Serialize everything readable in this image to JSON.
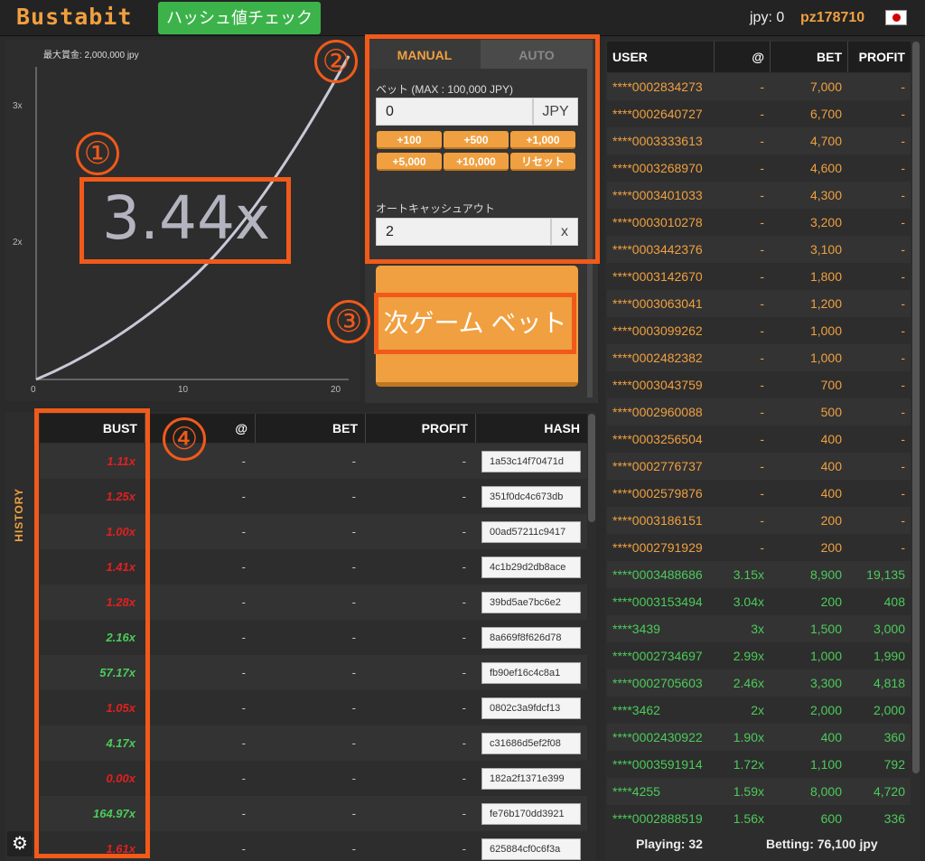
{
  "header": {
    "logo": "Bustabit",
    "hash_check_button": "ハッシュ値チェック",
    "balance_label": "jpy:",
    "balance_value": "0",
    "username": "pz178710"
  },
  "chart": {
    "max_profit_label": "最大賞金: 2,000,000 jpy",
    "current_multiplier": "3.44x",
    "y_ticks": [
      "3x",
      "2x"
    ],
    "x_ticks": [
      "0",
      "10",
      "20"
    ]
  },
  "annotations": [
    "①",
    "②",
    "③",
    "④"
  ],
  "bet_panel": {
    "tabs": [
      "MANUAL",
      "AUTO"
    ],
    "active_tab": "MANUAL",
    "bet_label": "ベット (MAX : 100,000 JPY)",
    "bet_value": "0",
    "currency": "JPY",
    "quick_buttons": [
      "+100",
      "+500",
      "+1,000",
      "+5,000",
      "+10,000",
      "リセット"
    ],
    "auto_cashout_label": "オートキャッシュアウト",
    "auto_cashout_value": "2",
    "auto_cashout_suffix": "x",
    "next_bet_button": "次ゲーム ベット",
    "accent_color": "#f0a040"
  },
  "history": {
    "side_label": "HISTORY",
    "columns": [
      "BUST",
      "@",
      "BET",
      "PROFIT",
      "HASH"
    ],
    "rows": [
      {
        "bust": "1.11x",
        "at": "-",
        "bet": "-",
        "profit": "-",
        "hash": "1a53c14f70471d",
        "status": "loss"
      },
      {
        "bust": "1.25x",
        "at": "-",
        "bet": "-",
        "profit": "-",
        "hash": "351f0dc4c673db",
        "status": "loss"
      },
      {
        "bust": "1.00x",
        "at": "-",
        "bet": "-",
        "profit": "-",
        "hash": "00ad57211c9417",
        "status": "loss"
      },
      {
        "bust": "1.41x",
        "at": "-",
        "bet": "-",
        "profit": "-",
        "hash": "4c1b29d2db8ace",
        "status": "loss"
      },
      {
        "bust": "1.28x",
        "at": "-",
        "bet": "-",
        "profit": "-",
        "hash": "39bd5ae7bc6e2",
        "status": "loss"
      },
      {
        "bust": "2.16x",
        "at": "-",
        "bet": "-",
        "profit": "-",
        "hash": "8a669f8f626d78",
        "status": "win"
      },
      {
        "bust": "57.17x",
        "at": "-",
        "bet": "-",
        "profit": "-",
        "hash": "fb90ef16c4c8a1",
        "status": "win"
      },
      {
        "bust": "1.05x",
        "at": "-",
        "bet": "-",
        "profit": "-",
        "hash": "0802c3a9fdcf13",
        "status": "loss"
      },
      {
        "bust": "4.17x",
        "at": "-",
        "bet": "-",
        "profit": "-",
        "hash": "c31686d5ef2f08",
        "status": "win"
      },
      {
        "bust": "0.00x",
        "at": "-",
        "bet": "-",
        "profit": "-",
        "hash": "182a2f1371e399",
        "status": "loss"
      },
      {
        "bust": "164.97x",
        "at": "-",
        "bet": "-",
        "profit": "-",
        "hash": "fe76b170dd3921",
        "status": "win"
      },
      {
        "bust": "1.61x",
        "at": "-",
        "bet": "-",
        "profit": "-",
        "hash": "625884cf0c6f3a",
        "status": "loss"
      }
    ],
    "win_color": "#4ccb5a",
    "loss_color": "#e02020"
  },
  "players": {
    "columns": [
      "USER",
      "@",
      "BET",
      "PROFIT"
    ],
    "rows": [
      {
        "user": "****0002834273",
        "at": "-",
        "bet": "7,000",
        "profit": "-",
        "status": "playing"
      },
      {
        "user": "****0002640727",
        "at": "-",
        "bet": "6,700",
        "profit": "-",
        "status": "playing"
      },
      {
        "user": "****0003333613",
        "at": "-",
        "bet": "4,700",
        "profit": "-",
        "status": "playing"
      },
      {
        "user": "****0003268970",
        "at": "-",
        "bet": "4,600",
        "profit": "-",
        "status": "playing"
      },
      {
        "user": "****0003401033",
        "at": "-",
        "bet": "4,300",
        "profit": "-",
        "status": "playing"
      },
      {
        "user": "****0003010278",
        "at": "-",
        "bet": "3,200",
        "profit": "-",
        "status": "playing"
      },
      {
        "user": "****0003442376",
        "at": "-",
        "bet": "3,100",
        "profit": "-",
        "status": "playing"
      },
      {
        "user": "****0003142670",
        "at": "-",
        "bet": "1,800",
        "profit": "-",
        "status": "playing"
      },
      {
        "user": "****0003063041",
        "at": "-",
        "bet": "1,200",
        "profit": "-",
        "status": "playing"
      },
      {
        "user": "****0003099262",
        "at": "-",
        "bet": "1,000",
        "profit": "-",
        "status": "playing"
      },
      {
        "user": "****0002482382",
        "at": "-",
        "bet": "1,000",
        "profit": "-",
        "status": "playing"
      },
      {
        "user": "****0003043759",
        "at": "-",
        "bet": "700",
        "profit": "-",
        "status": "playing"
      },
      {
        "user": "****0002960088",
        "at": "-",
        "bet": "500",
        "profit": "-",
        "status": "playing"
      },
      {
        "user": "****0003256504",
        "at": "-",
        "bet": "400",
        "profit": "-",
        "status": "playing"
      },
      {
        "user": "****0002776737",
        "at": "-",
        "bet": "400",
        "profit": "-",
        "status": "playing"
      },
      {
        "user": "****0002579876",
        "at": "-",
        "bet": "400",
        "profit": "-",
        "status": "playing"
      },
      {
        "user": "****0003186151",
        "at": "-",
        "bet": "200",
        "profit": "-",
        "status": "playing"
      },
      {
        "user": "****0002791929",
        "at": "-",
        "bet": "200",
        "profit": "-",
        "status": "playing"
      },
      {
        "user": "****0003488686",
        "at": "3.15x",
        "bet": "8,900",
        "profit": "19,135",
        "status": "cashed"
      },
      {
        "user": "****0003153494",
        "at": "3.04x",
        "bet": "200",
        "profit": "408",
        "status": "cashed"
      },
      {
        "user": "****3439",
        "at": "3x",
        "bet": "1,500",
        "profit": "3,000",
        "status": "cashed"
      },
      {
        "user": "****0002734697",
        "at": "2.99x",
        "bet": "1,000",
        "profit": "1,990",
        "status": "cashed"
      },
      {
        "user": "****0002705603",
        "at": "2.46x",
        "bet": "3,300",
        "profit": "4,818",
        "status": "cashed"
      },
      {
        "user": "****3462",
        "at": "2x",
        "bet": "2,000",
        "profit": "2,000",
        "status": "cashed"
      },
      {
        "user": "****0002430922",
        "at": "1.90x",
        "bet": "400",
        "profit": "360",
        "status": "cashed"
      },
      {
        "user": "****0003591914",
        "at": "1.72x",
        "bet": "1,100",
        "profit": "792",
        "status": "cashed"
      },
      {
        "user": "****4255",
        "at": "1.59x",
        "bet": "8,000",
        "profit": "4,720",
        "status": "cashed"
      },
      {
        "user": "****0002888519",
        "at": "1.56x",
        "bet": "600",
        "profit": "336",
        "status": "cashed"
      }
    ],
    "playing_label": "Playing: 32",
    "betting_label": "Betting: 76,100 jpy",
    "playing_color": "#f0a040",
    "cashed_color": "#4ccb5a"
  }
}
